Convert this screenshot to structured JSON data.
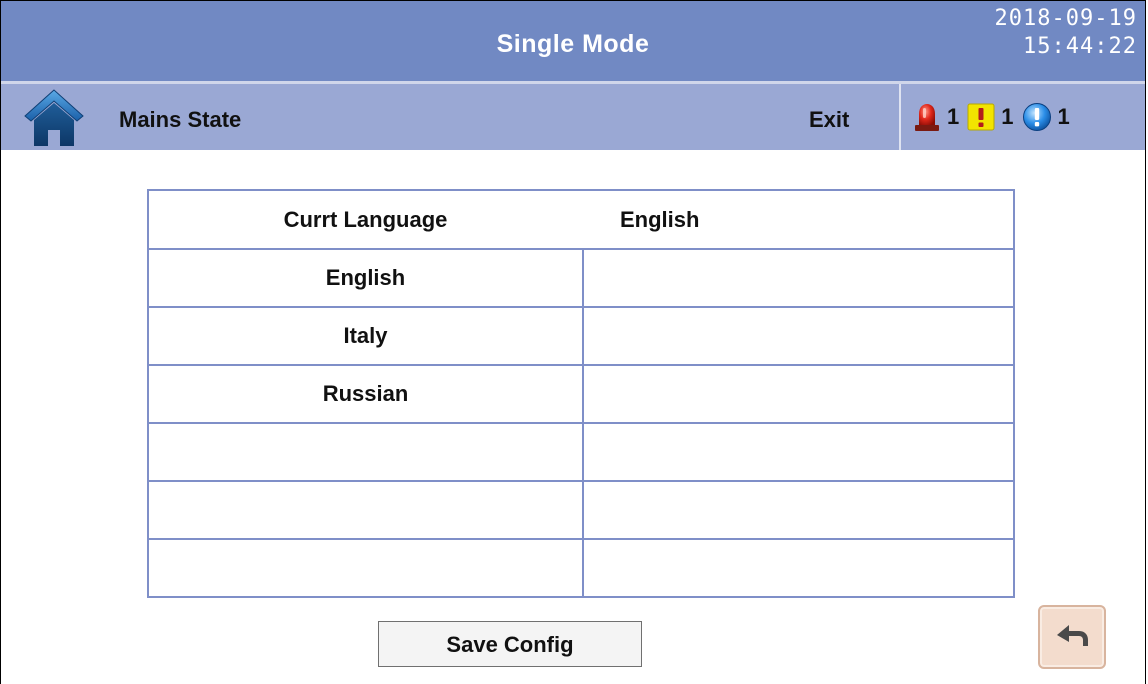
{
  "header": {
    "title": "Single Mode",
    "date": "2018-09-19",
    "time": "15:44:22"
  },
  "subheader": {
    "home_icon": "home-icon",
    "section_label": "Mains State",
    "exit_label": "Exit",
    "alarms": [
      {
        "icon": "siren-alarm-icon",
        "count": "1",
        "color": "#d42a1e"
      },
      {
        "icon": "warning-exclamation-icon",
        "count": "1",
        "color": "#f2e400"
      },
      {
        "icon": "info-exclamation-icon",
        "count": "1",
        "color": "#1f7fe0"
      }
    ]
  },
  "language_table": {
    "header_label": "Currt Language",
    "header_value": "English",
    "rows": [
      {
        "language": "English",
        "value": ""
      },
      {
        "language": "Italy",
        "value": ""
      },
      {
        "language": "Russian",
        "value": ""
      },
      {
        "language": "",
        "value": ""
      },
      {
        "language": "",
        "value": ""
      },
      {
        "language": "",
        "value": ""
      }
    ]
  },
  "actions": {
    "save_label": "Save Config",
    "back_icon": "back-arrow-icon"
  },
  "colors": {
    "topbar": "#7189c3",
    "subbar": "#9aa8d4",
    "table_border": "#7f8fc8"
  }
}
